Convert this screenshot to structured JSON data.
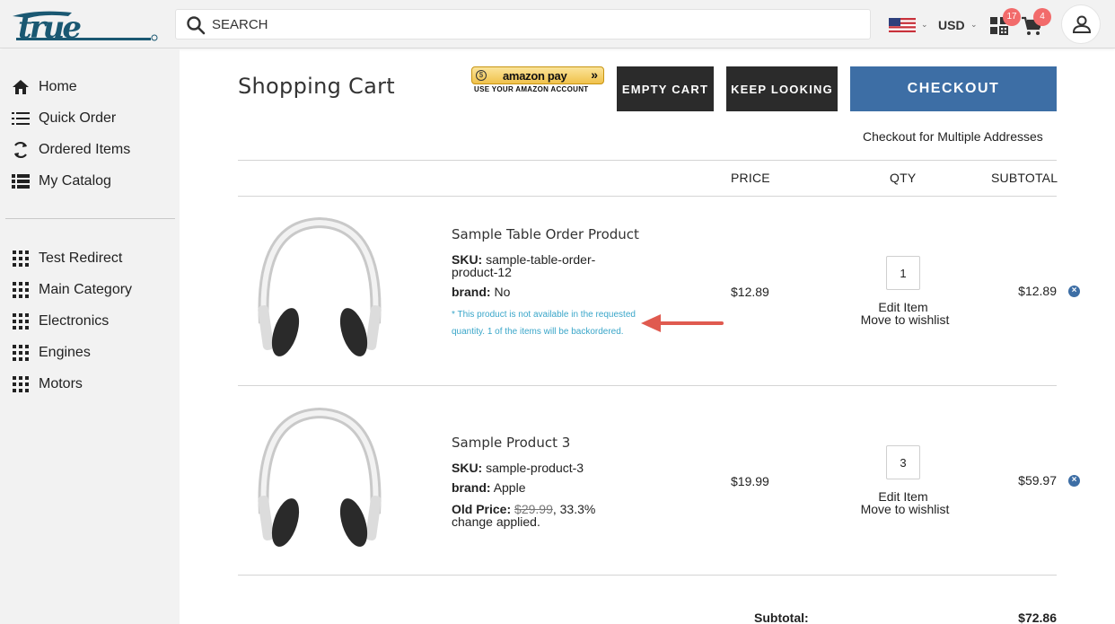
{
  "header": {
    "search_placeholder": "SEARCH",
    "currency": "USD",
    "quote_badge": "17",
    "cart_badge": "4",
    "logo_icon": "true-logo",
    "flag_icon": "us-flag-icon"
  },
  "sidebar": {
    "primary": [
      {
        "label": "Home",
        "icon": "home-icon"
      },
      {
        "label": "Quick Order",
        "icon": "list-icon"
      },
      {
        "label": "Ordered Items",
        "icon": "refresh-icon"
      },
      {
        "label": "My Catalog",
        "icon": "catalog-list-icon"
      }
    ],
    "categories": [
      {
        "label": "Test Redirect",
        "icon": "grid-icon"
      },
      {
        "label": "Main Category",
        "icon": "grid-icon"
      },
      {
        "label": "Electronics",
        "icon": "grid-icon"
      },
      {
        "label": "Engines",
        "icon": "grid-icon"
      },
      {
        "label": "Motors",
        "icon": "grid-icon"
      }
    ]
  },
  "main": {
    "title": "Shopping Cart",
    "amazon_pay_label": "amazon pay",
    "amazon_pay_sub": "USE YOUR AMAZON ACCOUNT",
    "empty_cart": "EMPTY CART",
    "keep_looking": "KEEP LOOKING",
    "checkout": "CHECKOUT",
    "multi_address": "Checkout for Multiple Addresses",
    "columns": {
      "price": "PRICE",
      "qty": "QTY",
      "subtotal": "SUBTOTAL"
    },
    "items": [
      {
        "name": "Sample Table Order Product",
        "sku_label": "SKU:",
        "sku_line1": "sample-table-order-",
        "sku_line2": "product-12",
        "brand_label": "brand:",
        "brand": "No",
        "warning": "* This product is not available in the requested quantity. 1 of the items will be backordered.",
        "price": "$12.89",
        "qty": "1",
        "edit": "Edit Item",
        "wishlist": "Move to wishlist",
        "subtotal": "$12.89"
      },
      {
        "name": "Sample Product 3",
        "sku_label": "SKU:",
        "sku": "sample-product-3",
        "brand_label": "brand:",
        "brand": "Apple",
        "old_price_label": "Old Price:",
        "old_price": "$29.99",
        "change_pct": ", 33.3%",
        "change_text": "change applied.",
        "price": "$19.99",
        "qty": "3",
        "edit": "Edit Item",
        "wishlist": "Move to wishlist",
        "subtotal": "$59.97"
      }
    ],
    "subtotal_label": "Subtotal:",
    "subtotal_value": "$72.86"
  },
  "colors": {
    "accent": "#3d6ea5",
    "dark_button": "#2b2b2b",
    "badge": "#f26b6b",
    "warning_text": "#3aa6c9",
    "annotation_arrow": "#e05a4f"
  }
}
